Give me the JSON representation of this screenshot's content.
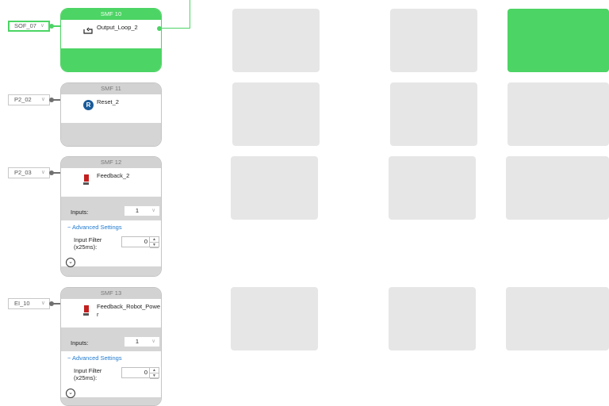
{
  "blocks": [
    {
      "header": "SMF 10",
      "name": "Output_Loop_2",
      "selector": "SOF_07",
      "type": "output-loop"
    },
    {
      "header": "SMF 11",
      "name": "Reset_2",
      "selector": "P2_02",
      "type": "reset",
      "icon_letter": "R"
    },
    {
      "header": "SMF 12",
      "name": "Feedback_2",
      "selector": "P2_03",
      "type": "feedback",
      "inputs_label": "Inputs:",
      "inputs_value": "1",
      "advanced_label": "− Advanced Settings",
      "filter_label_1": "Input Filter",
      "filter_label_2": "(x25ms):",
      "filter_value": "0"
    },
    {
      "header": "SMF 13",
      "name_line_1": "Feedback_Robot_Powe",
      "name_line_2": "r",
      "selector": "EI_10",
      "type": "feedback",
      "inputs_label": "Inputs:",
      "inputs_value": "1",
      "advanced_label": "− Advanced Settings",
      "filter_label_1": "Input Filter",
      "filter_label_2": "(x25ms):",
      "filter_value": "0"
    }
  ],
  "colors": {
    "active": "#4cd464",
    "inactive_wire": "#707070",
    "tile": "#e6e6e6",
    "link": "#1f7ad0",
    "reset_icon": "#1a5b9a",
    "feedback_icon": "#c21f1f"
  },
  "icons": {
    "dropdown": "chevron-down-icon",
    "expand": "chevron-circle-down-icon",
    "loop": "loop-icon"
  },
  "glyphs": {
    "dropdown_arrow": "∨",
    "expand": "⌄",
    "spin_up": "▲",
    "spin_down": "▼"
  }
}
